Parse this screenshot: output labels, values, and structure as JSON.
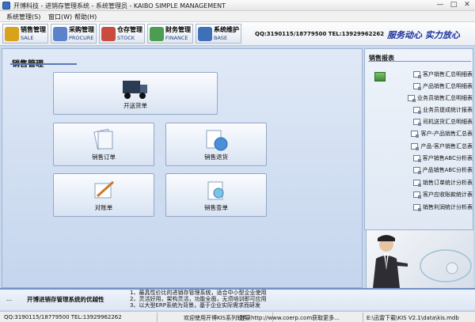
{
  "window": {
    "title": "开博科技 - 进销存管理系统 - 系统管理员 - KAIBO SIMPLE MANAGEMENT",
    "minimize": "—",
    "maximize": "□",
    "close": "✕"
  },
  "menu": [
    "系统管理(S)",
    "窗口(W)",
    "帮助(H)"
  ],
  "toolbar": {
    "buttons": [
      {
        "cn": "销售管理",
        "en": "SALE",
        "color": "#d9a21c"
      },
      {
        "cn": "采购管理",
        "en": "PROCURE",
        "color": "#5c83c9"
      },
      {
        "cn": "仓存管理",
        "en": "STOCK",
        "color": "#c94b3d"
      },
      {
        "cn": "财务管理",
        "en": "FINANCE",
        "color": "#4c9d52"
      },
      {
        "cn": "系统维护",
        "en": "BASE",
        "color": "#3f6fb8"
      }
    ],
    "contact": "QQ:3190115/18779500  TEL:13929962262",
    "slogan": "服务动心 实力放心"
  },
  "main": {
    "title": "销售管理",
    "tiles": [
      {
        "label": "开送货单",
        "icon": "truck-icon"
      },
      {
        "label": "销售订单",
        "icon": "documents-icon"
      },
      {
        "label": "销售退货",
        "icon": "return-globe-icon"
      },
      {
        "label": "对账单",
        "icon": "pen-paper-icon"
      },
      {
        "label": "销售查单",
        "icon": "search-docs-icon"
      }
    ]
  },
  "reports": {
    "title": "销售报表",
    "items": [
      "客户销售汇总明细表",
      "产品销售汇总明细表",
      "业务员销售汇总明细表",
      "业务员提成统计报表",
      "司机送货汇总明细表",
      "客户-产品销售汇总表",
      "产品-客户销售汇总表",
      "客户销售ABC分析表",
      "产品销售ABC分析表",
      "销售订单统计分析表",
      "客户应收账款统计表",
      "销售利润统计分析表"
    ]
  },
  "footer": {
    "dots": "...",
    "title": "开博进销存管理系统的优越性",
    "notes": [
      "1、最具性价比的进销存管理系统，适合中小型企业使用",
      "2、灵活好用，架构灵活，功能全面，无须培训即可应用",
      "3、以大型ERP系统为背景，基于企业实际需求而研发"
    ]
  },
  "statusbar": {
    "contact": "QQ:3190115/18779500  TEL:13929962262",
    "welcome": "欢迎使用开博KIS系列软件",
    "login": "登录http://www.coerp.com获取更多...",
    "path": "E:\\迅雷下载\\KIS V2.1\\data\\kis.mdb"
  }
}
